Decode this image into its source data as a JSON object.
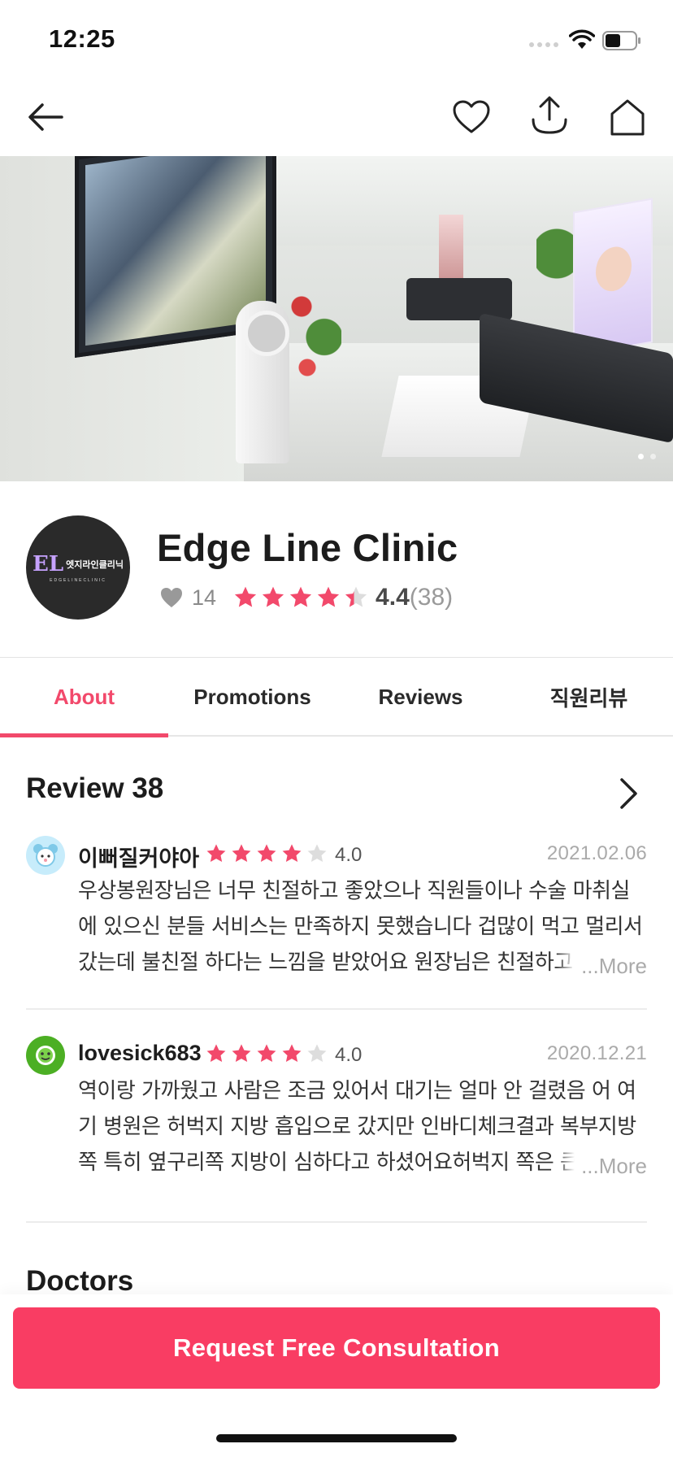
{
  "status_bar": {
    "time": "12:25"
  },
  "nav": {
    "back_icon": "back-arrow-icon",
    "favorite_icon": "heart-icon",
    "share_icon": "share-icon",
    "home_icon": "home-icon"
  },
  "hero": {
    "image_count": 2,
    "active_index": 0
  },
  "clinic": {
    "name": "Edge Line Clinic",
    "logo_text": "엣지라인클리닉",
    "logo_subtext": "EDGELINECLINIC",
    "likes": "14",
    "rating": "4.4",
    "rating_count": "(38)",
    "stars_value": 4.4
  },
  "tabs": [
    {
      "label": "About",
      "active": true
    },
    {
      "label": "Promotions",
      "active": false
    },
    {
      "label": "Reviews",
      "active": false
    },
    {
      "label": "직원리뷰",
      "active": false
    }
  ],
  "review_section": {
    "title": "Review 38",
    "more_label": "...More",
    "reviews": [
      {
        "author": "이뻐질커야아",
        "score": "4.0",
        "stars_value": 4,
        "date": "2021.02.06",
        "body": "우상봉원장님은 너무 친절하고 좋았으나 직원들이나 수술 마취실에 있으신 분들 서비스는 만족하지 못했습니다 겁많이 먹고 멀리서 갔는데 불친절 하다는 느낌을 받았어요 원장님은 친절하고 훈",
        "avatar_color": "#c7ecfb"
      },
      {
        "author": "lovesick683",
        "score": "4.0",
        "stars_value": 4,
        "date": "2020.12.21",
        "body": "역이랑 가까웠고  사람은 조금 있어서 대기는 얼마 안 걸렸음 어 여기 병원은  허벅지 지방 흡입으로 갔지만 인바디체크결과  복부지방쪽 특히 옆구리쪽 지방이 심하다고 하셨어요허벅지 쪽은 큰",
        "avatar_color": "#4caf24"
      }
    ]
  },
  "doctors_section": {
    "title": "Doctors"
  },
  "cta": {
    "label": "Request Free Consultation"
  },
  "colors": {
    "accent": "#f93d63",
    "tab_active": "#f2496b",
    "star": "#f2496b",
    "star_empty": "#dddddd"
  }
}
